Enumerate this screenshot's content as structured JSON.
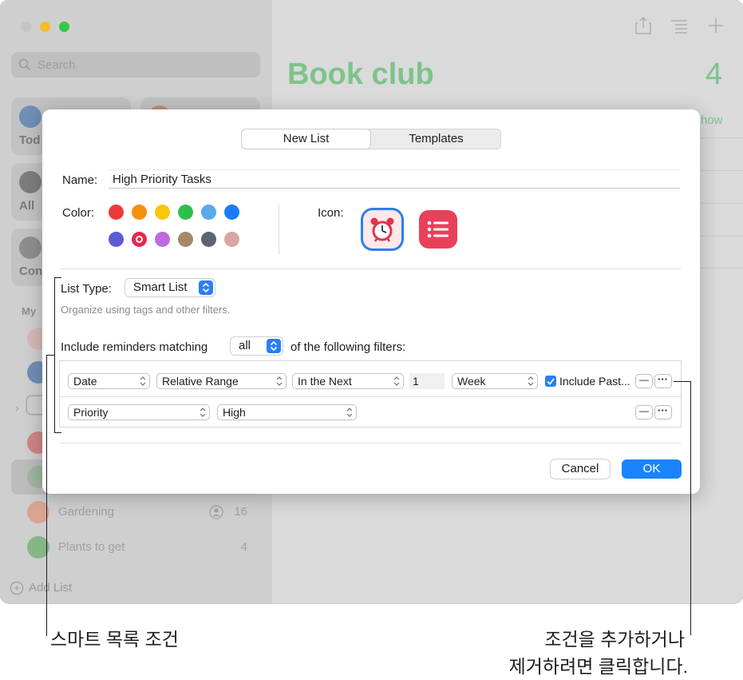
{
  "window": {
    "search_placeholder": "Search",
    "tiles": [
      "Tod",
      "",
      "All",
      "Con"
    ],
    "sidebar_section": "My",
    "rows": [
      {
        "name": "Gardening",
        "count": "16"
      },
      {
        "name": "Plants to get",
        "count": "4"
      }
    ],
    "add_list": "Add List",
    "main_title": "Book club",
    "main_count": "4",
    "main_show": "how"
  },
  "dialog": {
    "tabs": {
      "new_list": "New List",
      "templates": "Templates"
    },
    "name_label": "Name:",
    "name_value": "High Priority Tasks",
    "color_label": "Color:",
    "icon_label": "Icon:",
    "colors": [
      "#ee3a37",
      "#f5900c",
      "#f8c60a",
      "#2fbf4d",
      "#5aa9e8",
      "#1b7cf6",
      "#5d5bd6",
      "#e5294b",
      "#bd6ae0",
      "#a4886a",
      "#5d6670",
      "#dba5a1"
    ],
    "list_type_label": "List Type:",
    "list_type_value": "Smart List",
    "list_type_hint": "Organize using tags and other filters.",
    "include_prefix": "Include reminders matching",
    "match_value": "all",
    "include_suffix": "of the following filters:",
    "filter1": {
      "field": "Date",
      "mode": "Relative Range",
      "range": "In the Next",
      "amount": "1",
      "unit": "Week",
      "include_past": "Include Past..."
    },
    "filter2": {
      "field": "Priority",
      "value": "High"
    },
    "remove_symbol": "—",
    "more_symbol": "···",
    "cancel": "Cancel",
    "ok": "OK"
  },
  "callouts": {
    "left": "스마트 목록 조건",
    "right_line1": "조건을 추가하거나",
    "right_line2": "제거하려면 클릭합니다."
  }
}
